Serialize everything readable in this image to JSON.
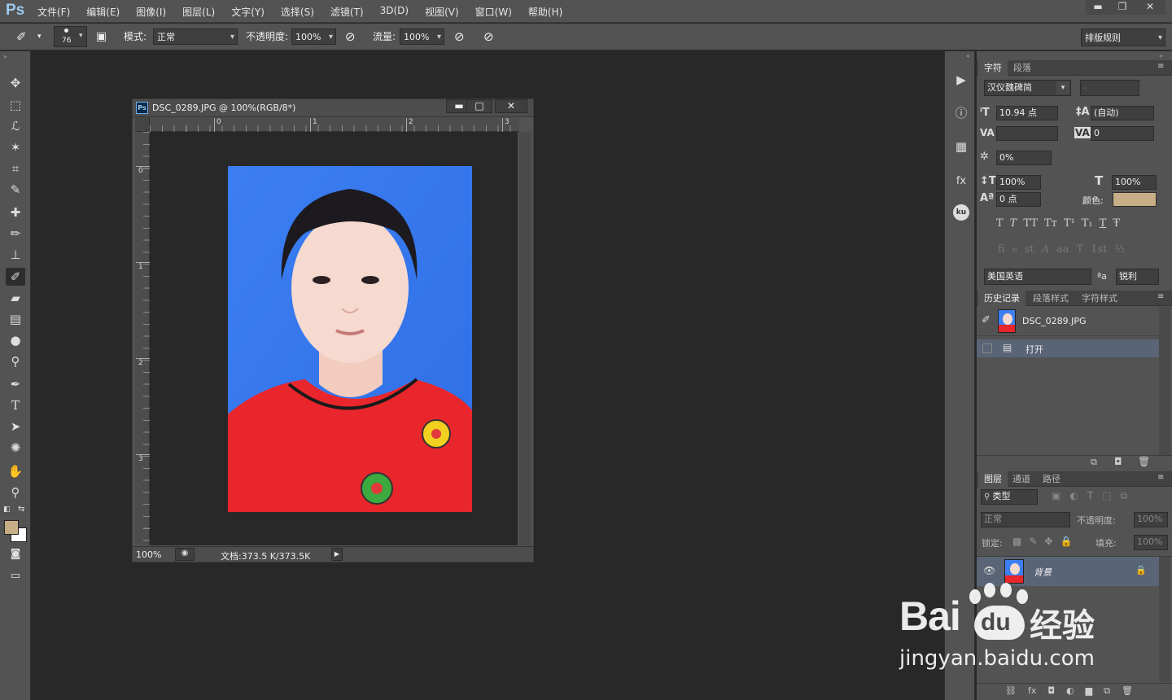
{
  "app": {
    "logo": "Ps"
  },
  "menubar": {
    "items": [
      "文件(F)",
      "编辑(E)",
      "图像(I)",
      "图层(L)",
      "文字(Y)",
      "选择(S)",
      "滤镜(T)",
      "3D(D)",
      "视图(V)",
      "窗口(W)",
      "帮助(H)"
    ]
  },
  "window_controls": {
    "minimize": "▬",
    "restore": "❐",
    "close": "✕"
  },
  "options": {
    "brush_size": "76",
    "mode_label": "模式:",
    "mode_value": "正常",
    "opacity_label": "不透明度:",
    "opacity_value": "100%",
    "flow_label": "流量:",
    "flow_value": "100%",
    "workspace": "排版规则"
  },
  "document": {
    "title": "DSC_0289.JPG @ 100%(RGB/8*)",
    "ruler_top": [
      "0",
      "1",
      "2",
      "3"
    ],
    "ruler_left": [
      "0",
      "1",
      "2",
      "3"
    ],
    "zoom": "100%",
    "status": "文档:373.5 K/373.5K",
    "icon_text": "Ps"
  },
  "character_panel": {
    "tabs": [
      "字符",
      "段落"
    ],
    "font_family": "汉仪魏碑简",
    "font_style": "-",
    "font_size": "10.94 点",
    "leading": "(自动)",
    "kerning": "",
    "tracking": "0",
    "tsume": "0%",
    "vscale": "100%",
    "hscale": "100%",
    "baseline": "0 点",
    "color_label": "颜色:",
    "color": "#c8ae86",
    "style_row1": [
      "T",
      "T",
      "TT",
      "Tт",
      "T¹",
      "T₁",
      "T",
      "Ŧ"
    ],
    "style_row2": [
      "fi",
      "ℴ",
      "st",
      "A",
      "aa",
      "T",
      "1st",
      "½"
    ],
    "language": "美国英语",
    "aa_icon": "ªa",
    "antialias": "锐利"
  },
  "history_panel": {
    "tabs": [
      "历史记录",
      "段落样式",
      "字符样式"
    ],
    "snapshot": "DSC_0289.JPG",
    "states": [
      "打开"
    ]
  },
  "layers_panel": {
    "tabs": [
      "图层",
      "通道",
      "路径"
    ],
    "filter": "类型",
    "blend": "正常",
    "opacity_label": "不透明度:",
    "opacity": "100%",
    "lock_label": "锁定:",
    "fill_label": "填充:",
    "fill": "100%",
    "layers": [
      {
        "name": "背景",
        "locked": true,
        "visible": true
      }
    ]
  },
  "watermark": {
    "brand": "Bai",
    "brand2": "du",
    "cn": "经验",
    "url": "jingyan.baidu.com"
  },
  "colors": {
    "foreground": "#c8ae86",
    "background": "#ffffff",
    "photo_bg": "#3d7ef0",
    "shirt": "#e8262b"
  }
}
